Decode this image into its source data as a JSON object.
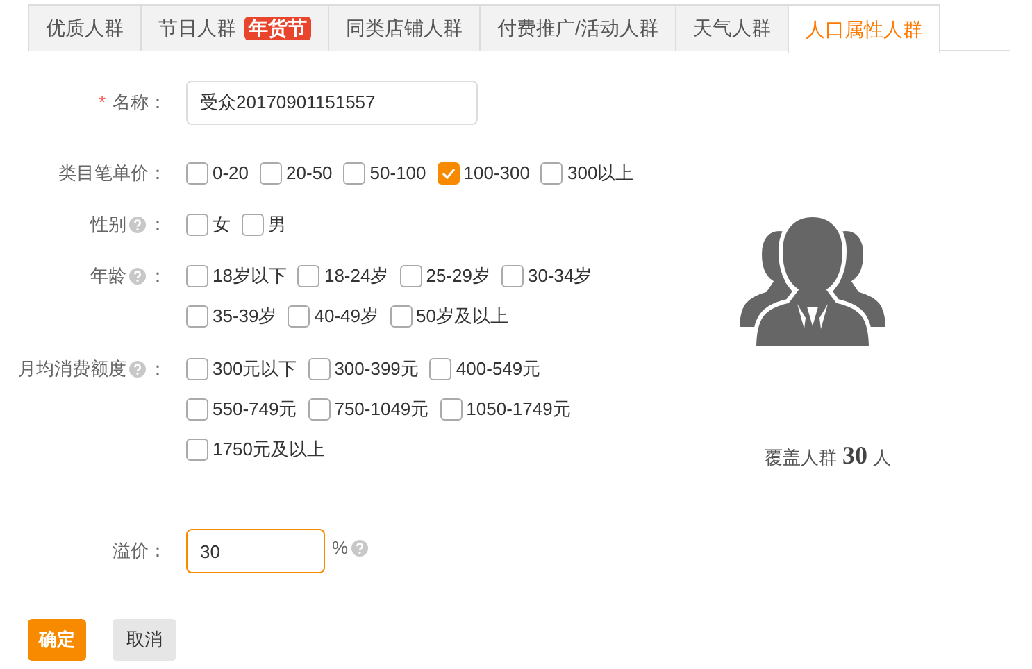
{
  "tabs": [
    {
      "label": "优质人群",
      "selected": false
    },
    {
      "label": "节日人群",
      "badge": "年货节",
      "selected": false
    },
    {
      "label": "同类店铺人群",
      "selected": false
    },
    {
      "label": "付费推广/活动人群",
      "selected": false
    },
    {
      "label": "天气人群",
      "selected": false
    },
    {
      "label": "人口属性人群",
      "selected": true
    }
  ],
  "name_field": {
    "required_mark": "*",
    "label": "名称：",
    "value": "受众20170901151557"
  },
  "groups": [
    {
      "label": "类目笔单价：",
      "help": false,
      "rows": [
        [
          {
            "label": "0-20",
            "checked": false
          },
          {
            "label": "20-50",
            "checked": false
          },
          {
            "label": "50-100",
            "checked": false
          },
          {
            "label": "100-300",
            "checked": true
          },
          {
            "label": "300以上",
            "checked": false
          }
        ]
      ]
    },
    {
      "label": "性别",
      "help": true,
      "colon": "：",
      "rows": [
        [
          {
            "label": "女",
            "checked": false
          },
          {
            "label": "男",
            "checked": false
          }
        ]
      ]
    },
    {
      "label": "年龄",
      "help": true,
      "colon": "：",
      "rows": [
        [
          {
            "label": "18岁以下",
            "checked": false
          },
          {
            "label": "18-24岁",
            "checked": false
          },
          {
            "label": "25-29岁",
            "checked": false
          },
          {
            "label": "30-34岁",
            "checked": false
          }
        ],
        [
          {
            "label": "35-39岁",
            "checked": false
          },
          {
            "label": "40-49岁",
            "checked": false
          },
          {
            "label": "50岁及以上",
            "checked": false
          }
        ]
      ]
    },
    {
      "label": "月均消费额度",
      "help": true,
      "colon": "：",
      "rows": [
        [
          {
            "label": "300元以下",
            "checked": false
          },
          {
            "label": "300-399元",
            "checked": false
          },
          {
            "label": "400-549元",
            "checked": false
          }
        ],
        [
          {
            "label": "550-749元",
            "checked": false
          },
          {
            "label": "750-1049元",
            "checked": false
          },
          {
            "label": "1050-1749元",
            "checked": false
          }
        ],
        [
          {
            "label": "1750元及以上",
            "checked": false
          }
        ]
      ]
    }
  ],
  "premium": {
    "label": "溢价：",
    "value": "30",
    "unit": "%",
    "help": true
  },
  "coverage": {
    "prefix": "覆盖人群",
    "count": "30",
    "suffix": "人"
  },
  "buttons": [
    {
      "label": "确定",
      "kind": "primary"
    },
    {
      "label": "取消",
      "kind": "secondary"
    }
  ]
}
